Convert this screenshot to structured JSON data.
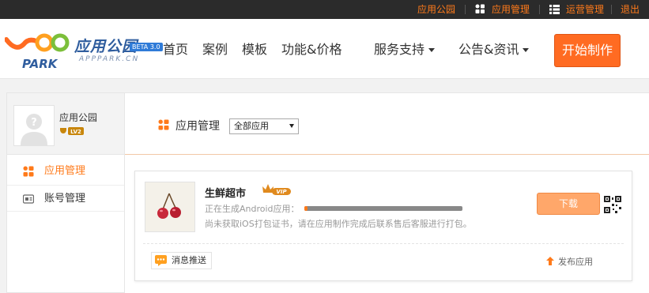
{
  "topbar": {
    "links": [
      "应用公园",
      "应用管理",
      "运营管理",
      "退出"
    ]
  },
  "logo": {
    "cn": "应用公园",
    "en": "APPPARK.CN",
    "beta": "BETA 3.0"
  },
  "nav": {
    "items": [
      "首页",
      "案例",
      "模板",
      "功能&价格",
      "服务支持",
      "公告&资讯"
    ],
    "start_button": "开始制作"
  },
  "sidebar": {
    "username": "应用公园",
    "level": "LV2",
    "items": [
      "应用管理",
      "账号管理"
    ]
  },
  "main": {
    "title": "应用管理",
    "filter_value": "全部应用",
    "app": {
      "name": "生鲜超市",
      "badge": "VIP",
      "status": "正在生成Android应用：",
      "progress": 0.02,
      "notice": "尚未获取iOS打包证书，请在应用制作完成后联系售后客服进行打包。",
      "download_label": "下载",
      "push_label": "消息推送",
      "publish_label": "发布应用"
    }
  },
  "colors": {
    "accent": "#ff7a1a",
    "start_button": "#ff6b22",
    "download_button": "#ffa76a",
    "topbar": "#2b2b2b"
  },
  "icons": [
    "apps-grid-icon",
    "list-icon",
    "account-icon",
    "qr-code-icon",
    "message-icon",
    "publish-up-icon",
    "avatar-placeholder-icon",
    "cherry-app-icon",
    "vip-crown-icon",
    "level-badge-icon"
  ]
}
